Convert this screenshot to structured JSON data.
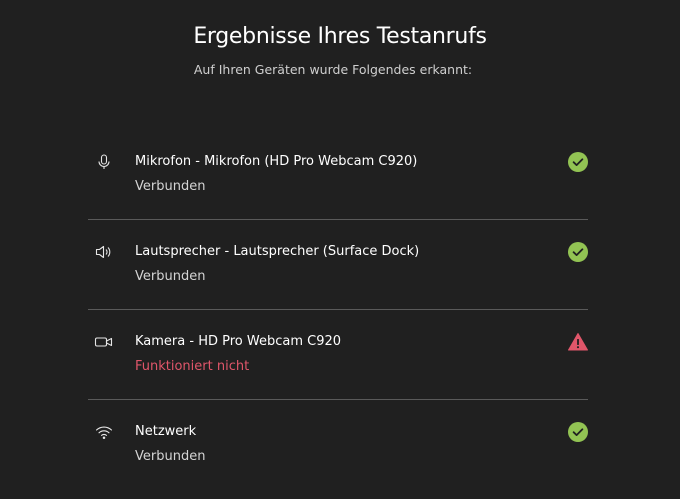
{
  "header": {
    "title": "Ergebnisse Ihres Testanrufs",
    "subtitle": "Auf Ihren Geräten wurde Folgendes erkannt:"
  },
  "devices": [
    {
      "name": "Mikrofon - Mikrofon (HD Pro Webcam C920)",
      "status": "Verbunden",
      "icon": "microphone-icon",
      "state": "ok"
    },
    {
      "name": "Lautsprecher - Lautsprecher (Surface Dock)",
      "status": "Verbunden",
      "icon": "speaker-icon",
      "state": "ok"
    },
    {
      "name": "Kamera - HD Pro Webcam C920",
      "status": "Funktioniert nicht",
      "icon": "camera-icon",
      "state": "error"
    },
    {
      "name": "Netzwerk",
      "status": "Verbunden",
      "icon": "wifi-icon",
      "state": "ok"
    }
  ],
  "colors": {
    "background": "#202020",
    "ok": "#92c353",
    "error": "#e0566a",
    "divider": "#5a5a5a"
  }
}
